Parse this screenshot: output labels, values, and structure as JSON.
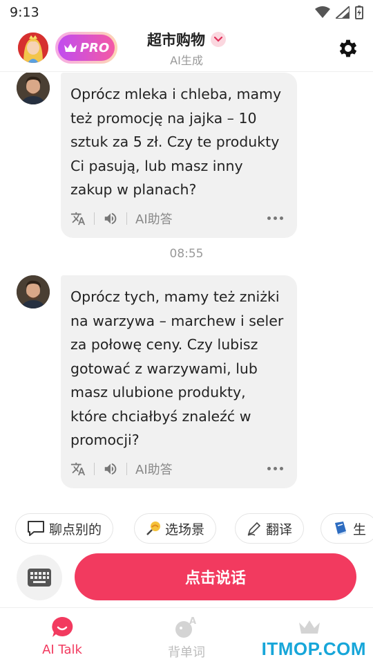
{
  "status_bar": {
    "time": "9:13"
  },
  "header": {
    "pro_label": "PRO",
    "title": "超市购物",
    "subtitle": "AI生成"
  },
  "messages": [
    {
      "text": "Oprócz mleka i chleba, mamy też promocję na jajka – 10 sztuk za 5 zł. Czy te produkty Ci pasują, lub masz inny zakup w planach?",
      "tools": {
        "ai_answer": "AI助答"
      }
    },
    {
      "text": "Oprócz tych, mamy też zniżki na warzywa – marchew i seler za połowę ceny. Czy lubisz gotować z warzywami, lub masz ulubione produkty, które chciałbyś znaleźć w promocji?",
      "tools": {
        "ai_answer": "AI助答"
      }
    }
  ],
  "timestamp": "08:55",
  "chips": [
    {
      "label": "聊点别的",
      "icon": "speech-bubble-icon"
    },
    {
      "label": "选场景",
      "icon": "lollipop-icon"
    },
    {
      "label": "翻译",
      "icon": "pen-icon"
    },
    {
      "label": "生",
      "icon": "book-icon"
    }
  ],
  "talk_button": "点击说话",
  "bottom_nav": [
    {
      "label": "AI Talk",
      "active": true
    },
    {
      "label": "背单词",
      "active": false
    },
    {
      "label": "",
      "active": false
    }
  ],
  "watermark": "ITMOP.COM",
  "colors": {
    "accent": "#f23a5f",
    "bubble": "#f1f1f1",
    "watermark": "#17a6d9"
  }
}
